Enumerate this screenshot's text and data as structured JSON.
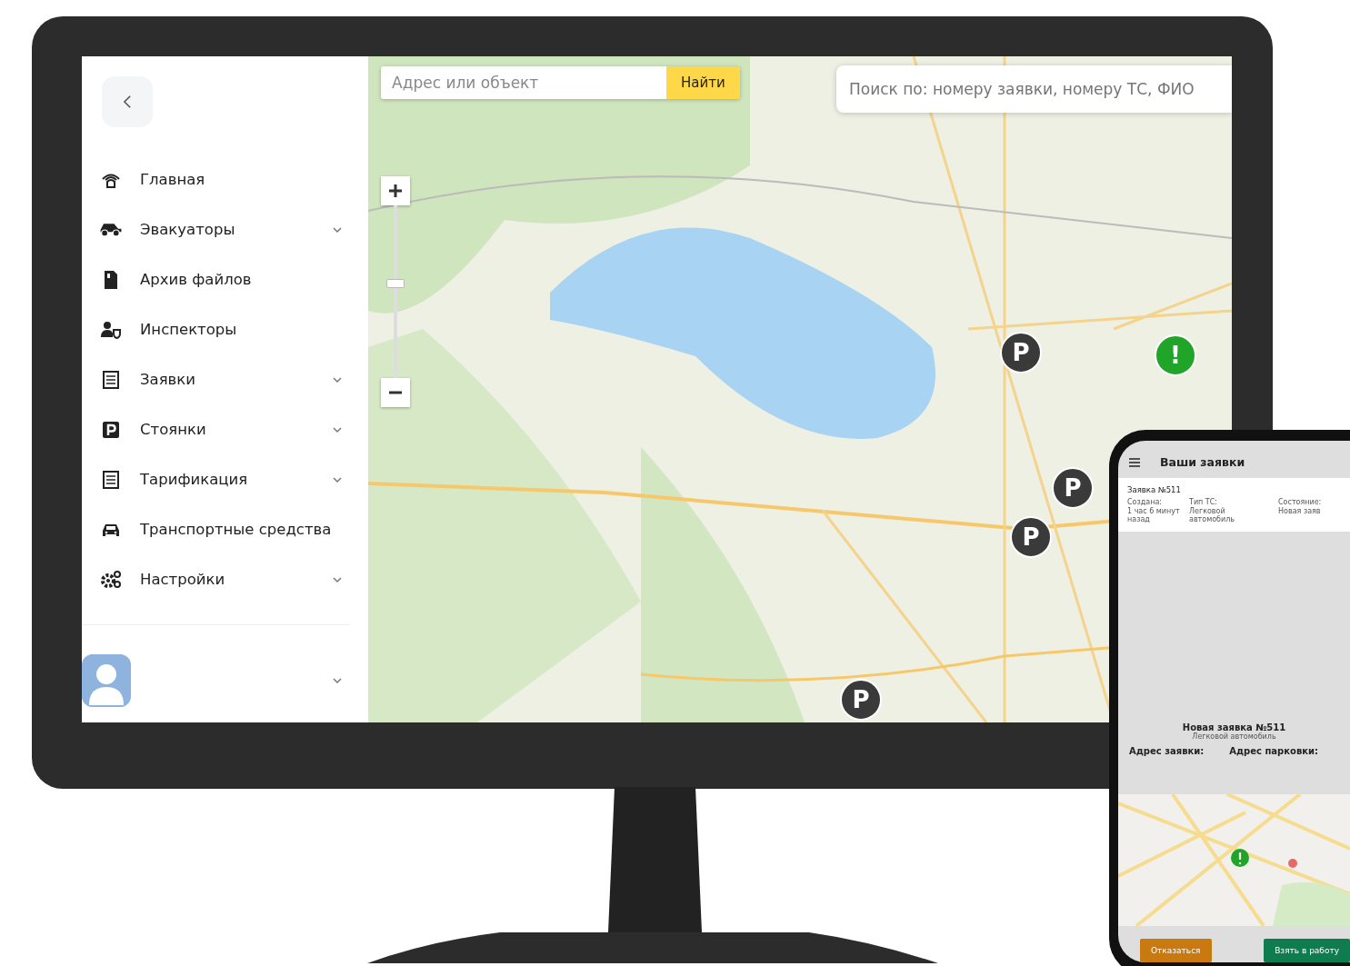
{
  "sidebar": {
    "items": [
      {
        "label": "Главная",
        "expandable": false
      },
      {
        "label": "Эвакуаторы",
        "expandable": true
      },
      {
        "label": "Архив файлов",
        "expandable": false
      },
      {
        "label": "Инспекторы",
        "expandable": false
      },
      {
        "label": "Заявки",
        "expandable": true
      },
      {
        "label": "Стоянки",
        "expandable": true
      },
      {
        "label": "Тарификация",
        "expandable": true
      },
      {
        "label": "Транспортные средства",
        "expandable": false
      },
      {
        "label": "Настройки",
        "expandable": true
      }
    ]
  },
  "map": {
    "address_search": {
      "placeholder": "Адрес или объект",
      "button": "Найти"
    },
    "request_search": {
      "placeholder": "Поиск по: номеру заявки, номеру ТС, ФИО"
    },
    "zoom": {
      "level": 0.55
    },
    "markers": [
      {
        "kind": "parking",
        "label": "P"
      },
      {
        "kind": "alert",
        "label": "!"
      },
      {
        "kind": "parking",
        "label": "P"
      },
      {
        "kind": "parking",
        "label": "P"
      },
      {
        "kind": "parking",
        "label": "P"
      }
    ]
  },
  "phone": {
    "title": "Ваши заявки",
    "request": {
      "title": "Заявка №511",
      "fields": [
        {
          "label": "Создана:",
          "value": "1 час 6 минут назад"
        },
        {
          "label": "Тип ТС:",
          "value": "Легковой автомобиль"
        },
        {
          "label": "Состояние:",
          "value": "Новая заяв"
        }
      ]
    },
    "sheet": {
      "title": "Новая заявка №511",
      "subtitle": "Легковой автомобиль",
      "columns": [
        "Адрес заявки:",
        "Адрес парковки:"
      ],
      "buttons": [
        {
          "label": "Отказаться",
          "kind": "decline"
        },
        {
          "label": "Взять в работу",
          "kind": "accept"
        }
      ]
    }
  }
}
